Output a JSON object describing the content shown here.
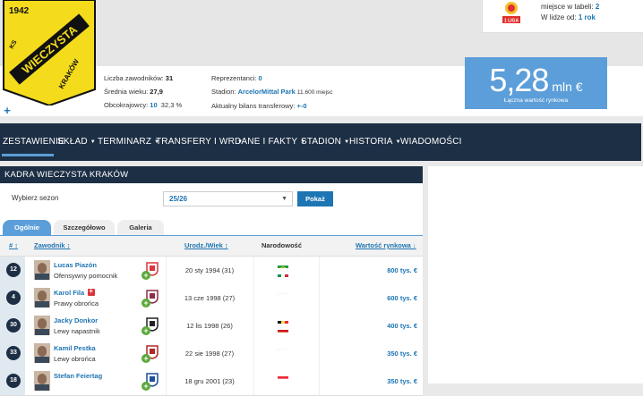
{
  "club": {
    "founded": "1942",
    "logo_top": "KS",
    "logo_name": "WIECZYSTA",
    "logo_city": "KRAKÓW"
  },
  "league": {
    "logo_text": "1 LIGA",
    "table_label": "miejsce w tabeli:",
    "table_value": "2",
    "since_label": "W lidze od:",
    "since_value": "1 rok"
  },
  "stats": {
    "players_label": "Liczba zawodników:",
    "players_value": "31",
    "age_label": "Średnia wieku:",
    "age_value": "27,9",
    "foreigners_label": "Obcokrajowcy:",
    "foreigners_value": "10",
    "foreigners_pct": "32,3 %",
    "national_label": "Reprezentanci:",
    "national_value": "0",
    "stadium_label": "Stadion:",
    "stadium_value": "ArcelorMittal Park",
    "stadium_seats": "11.600 miejsc",
    "transfer_label": "Aktualny bilans transferowy:",
    "transfer_value": "+-0"
  },
  "market_value": {
    "amount": "5,28",
    "unit": "mln €",
    "caption": "Łączna wartość rynkowa"
  },
  "nav": {
    "items": [
      {
        "label": "ZESTAWIENIE",
        "dropdown": false
      },
      {
        "label": "SKŁAD",
        "dropdown": true
      },
      {
        "label": "TERMINARZ",
        "dropdown": true
      },
      {
        "label": "TRANSFERY I WR",
        "dropdown": true
      },
      {
        "label": "DANE I FAKTY",
        "dropdown": true
      },
      {
        "label": "STADION",
        "dropdown": true
      },
      {
        "label": "HISTORIA",
        "dropdown": true
      },
      {
        "label": "WIADOMOŚCI",
        "dropdown": false
      }
    ],
    "caret": "▼",
    "settings_icon": "gear-icon"
  },
  "squad": {
    "title": "KADRA WIECZYSTA KRAKÓW",
    "season_label": "Wybierz sezon",
    "season_value": "25/26",
    "season_arrow": "▼",
    "show_button": "Pokaż",
    "tabs": [
      {
        "label": "Ogólnie",
        "active": true
      },
      {
        "label": "Szczegółowo",
        "active": false
      },
      {
        "label": "Galeria",
        "active": false
      }
    ],
    "headers": {
      "number": "# ↕",
      "player": "Zawodnik ↕",
      "dob": "Urodz./Wiek ↕",
      "nationality": "Narodowość",
      "value": "Wartość rynkowa ↓"
    },
    "players": [
      {
        "number": "12",
        "name": "Lucas Piazón",
        "position": "Ofensywny pomocnik",
        "dob": "20 sty 1994 (31)",
        "flags": [
          "brazil",
          "italy"
        ],
        "value": "800 tys. €",
        "injured": false
      },
      {
        "number": "4",
        "name": "Karol Fila",
        "position": "Prawy obrońca",
        "dob": "13 cze 1998 (27)",
        "flags": [
          "poland"
        ],
        "value": "600 tys. €",
        "injured": true
      },
      {
        "number": "30",
        "name": "Jacky Donkor",
        "position": "Lewy napastnik",
        "dob": "12 lis 1998 (26)",
        "flags": [
          "belgium",
          "ghana"
        ],
        "value": "400 tys. €",
        "injured": false
      },
      {
        "number": "33",
        "name": "Kamil Pestka",
        "position": "Lewy obrońca",
        "dob": "22 sie 1998 (27)",
        "flags": [
          "poland"
        ],
        "value": "350 tys. €",
        "injured": false
      },
      {
        "number": "18",
        "name": "Stefan Feiertag",
        "position": "",
        "dob": "18 gru 2001 (23)",
        "flags": [
          "austria"
        ],
        "value": "350 tys. €",
        "injured": false
      }
    ]
  },
  "colors": {
    "nav_bg": "#1d2f45",
    "accent": "#5b9ed9",
    "link": "#1d75b3",
    "logo_yellow": "#f4dc1c"
  }
}
